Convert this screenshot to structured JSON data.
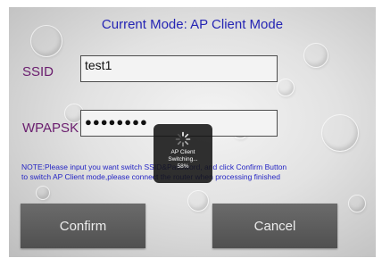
{
  "header": {
    "title": "Current Mode: AP Client Mode"
  },
  "form": {
    "ssid_label": "SSID",
    "ssid_value": "test1",
    "wpapsk_label": "WPAPSK",
    "wpapsk_value": "●●●●●●●●"
  },
  "note": {
    "line1": "NOTE:Please input you want switch                 SSID&Password, and click Confirm Button",
    "line2": "to switch AP Client mode,please            connect the router when processing finished"
  },
  "buttons": {
    "confirm": "Confirm",
    "cancel": "Cancel"
  },
  "progress": {
    "line1": "AP Client",
    "line2": "Switching...",
    "percent_text": "58%",
    "percent": 58
  }
}
